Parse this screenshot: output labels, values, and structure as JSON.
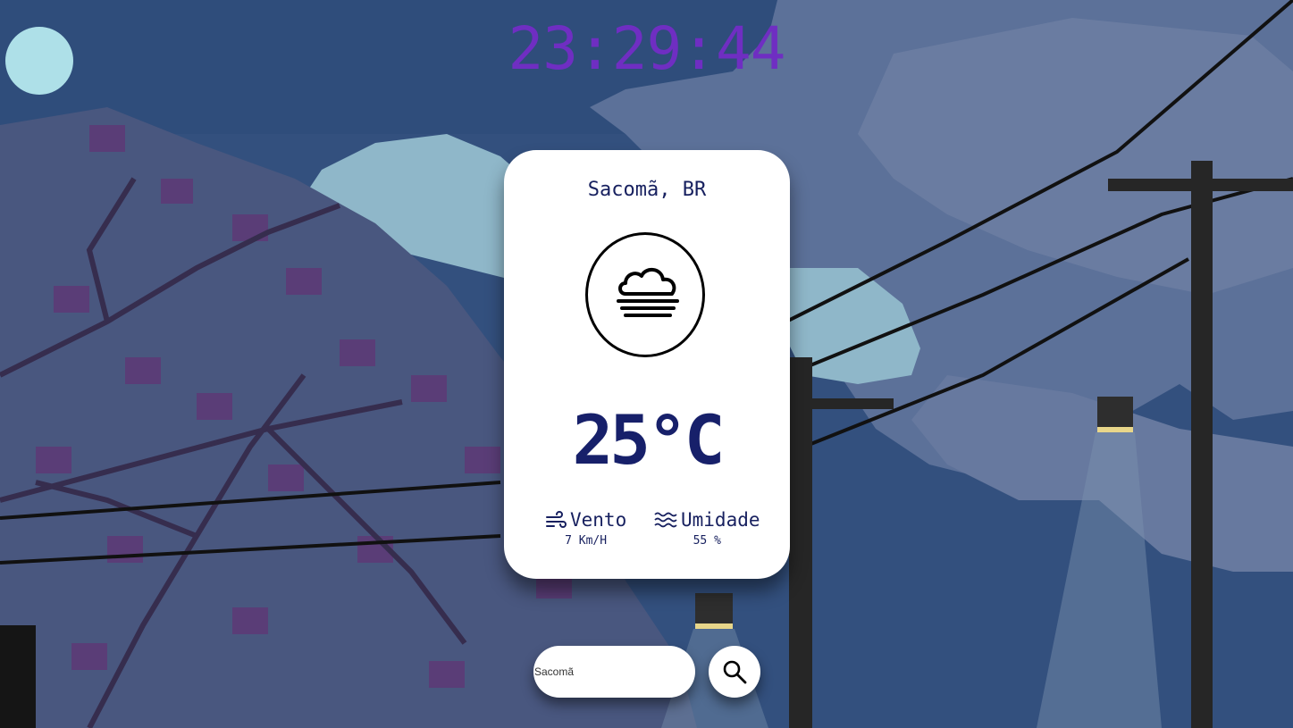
{
  "clock": {
    "time": "23:29:44"
  },
  "weather": {
    "location": "Sacomã, BR",
    "condition_icon": "fog-cloud-icon",
    "temperature": "25°C",
    "wind": {
      "label": "Vento",
      "value": "7 Km/H",
      "icon": "wind-icon"
    },
    "humidity": {
      "label": "Umidade",
      "value": "55 %",
      "icon": "humidity-waves-icon"
    }
  },
  "search": {
    "value": "Sacomã",
    "button_icon": "search-icon"
  },
  "colors": {
    "clock": "#6f2ec2",
    "card_text": "#17205f",
    "card_bg": "#ffffff",
    "sky": "#33507e"
  }
}
